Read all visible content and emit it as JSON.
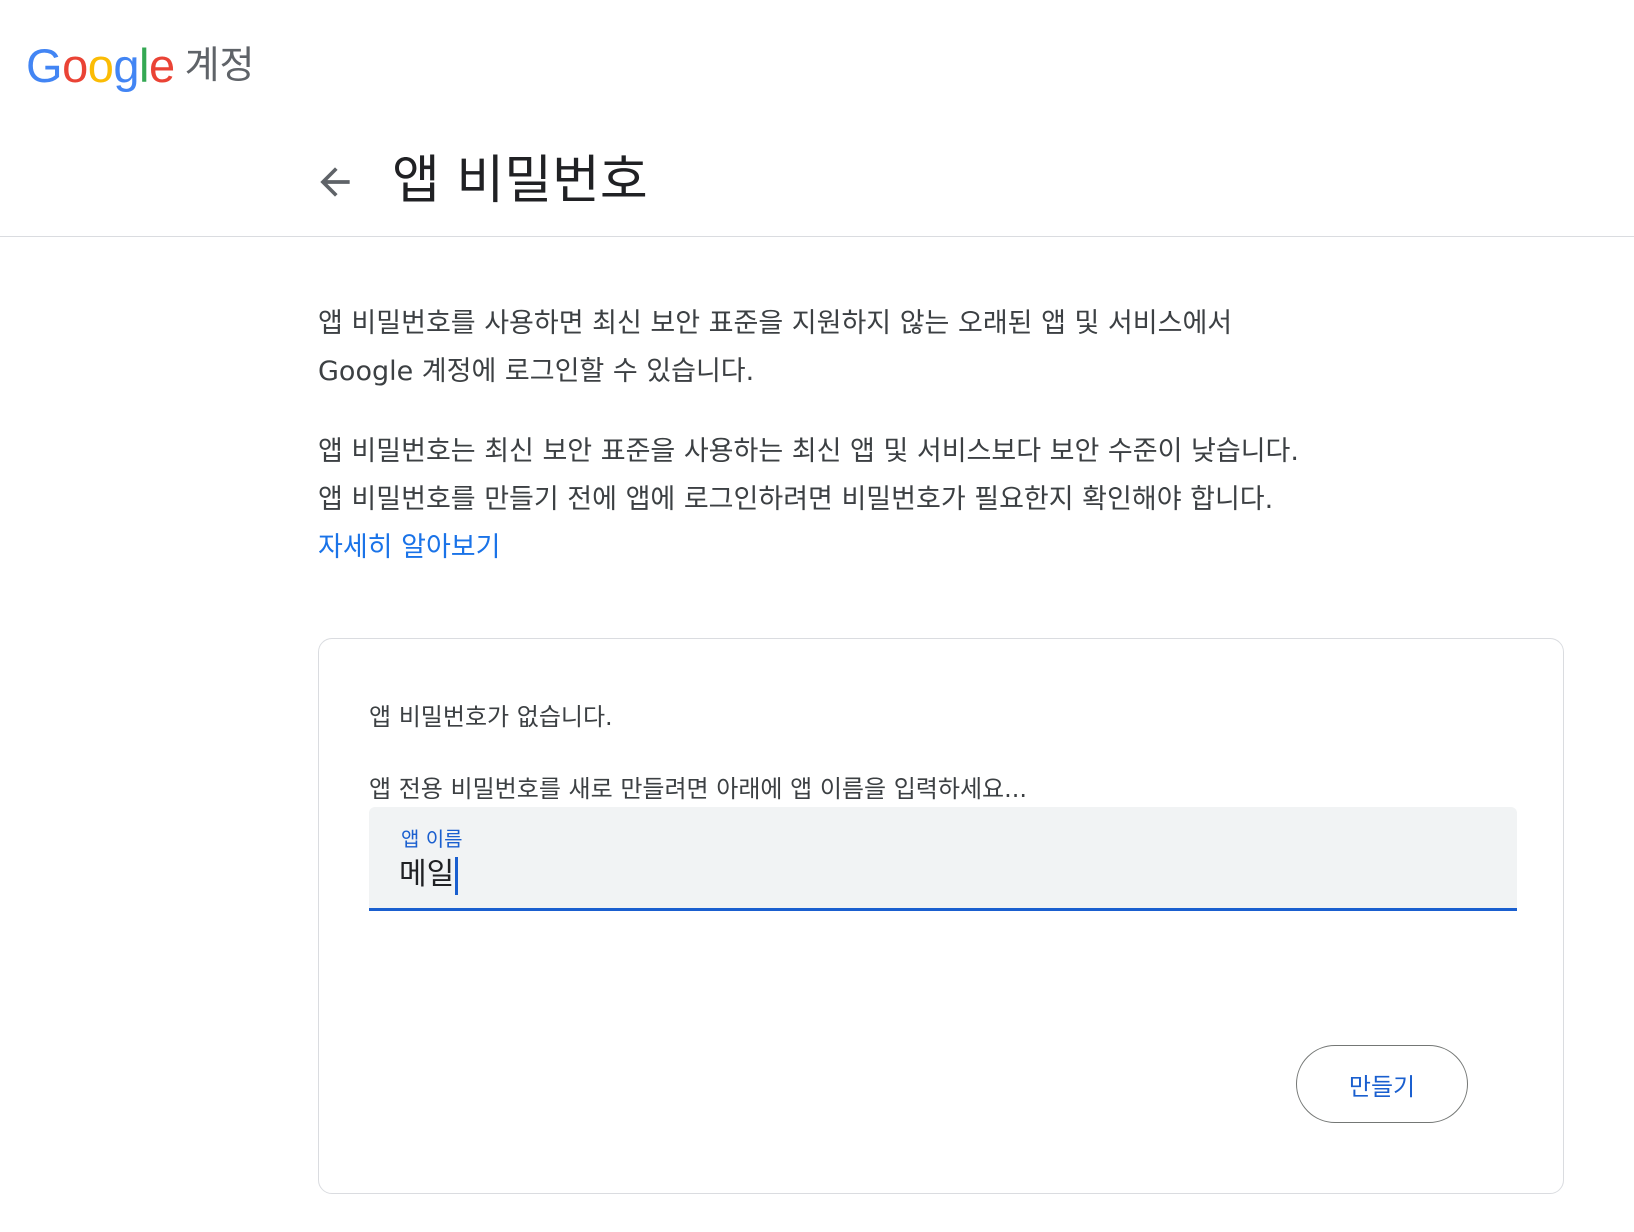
{
  "header": {
    "logo_letters": [
      "G",
      "o",
      "o",
      "g",
      "l",
      "e"
    ],
    "product_name": "계정"
  },
  "titlebar": {
    "back_icon": "arrow-back-icon",
    "title": "앱 비밀번호"
  },
  "description": {
    "line1": "앱 비밀번호를 사용하면 최신 보안 표준을 지원하지 않는 오래된 앱 및 서비스에서",
    "line2": "Google 계정에 로그인할 수 있습니다.",
    "line3": "앱 비밀번호는 최신 보안 표준을 사용하는 최신 앱 및 서비스보다 보안 수준이 낮습니다.",
    "line4": "앱 비밀번호를 만들기 전에 앱에 로그인하려면 비밀번호가 필요한지 확인해야 합니다.",
    "learn_more": "자세히 알아보기"
  },
  "card": {
    "no_passwords": "앱 비밀번호가 없습니다.",
    "instruction": "앱 전용 비밀번호를 새로 만들려면 아래에 앱 이름을 입력하세요...",
    "field_label": "앱 이름",
    "field_value": "메일",
    "create_button": "만들기"
  },
  "colors": {
    "google_blue": "#4285F4",
    "google_red": "#EA4335",
    "google_yellow": "#FBBC05",
    "google_green": "#34A853",
    "link": "#1a73e8",
    "accent": "#1a5fcf"
  }
}
